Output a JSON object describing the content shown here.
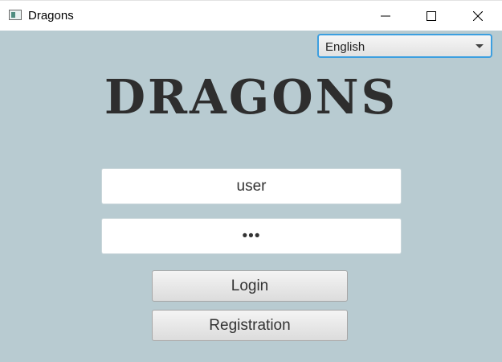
{
  "window": {
    "title": "Dragons",
    "minimize_icon": "minimize-icon",
    "maximize_icon": "maximize-icon",
    "close_icon": "close-icon"
  },
  "language_select": {
    "selected": "English"
  },
  "logo": {
    "text": "DRAGONS"
  },
  "login_form": {
    "username_value": "user",
    "password_value": "•••",
    "login_label": "Login",
    "registration_label": "Registration"
  },
  "colors": {
    "background": "#b8cbd1",
    "focus_border": "#3c9fe0",
    "logo": "#2e2e2e"
  }
}
